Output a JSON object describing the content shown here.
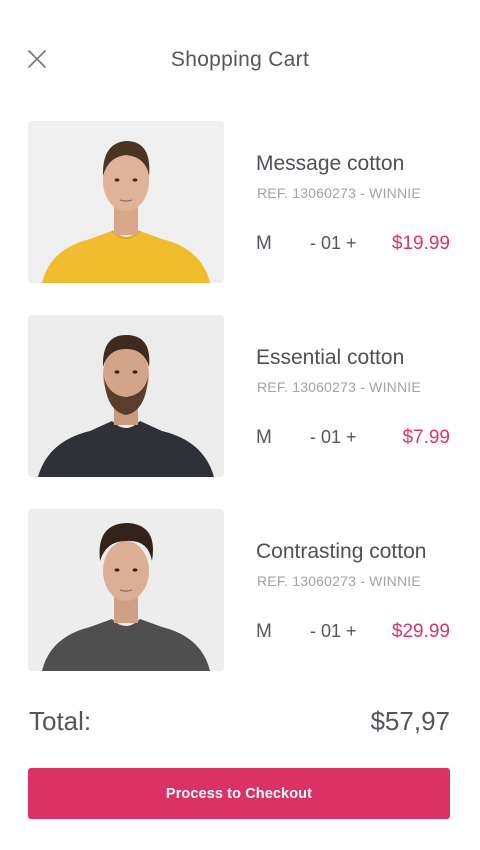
{
  "header": {
    "title": "Shopping Cart",
    "close_icon": "close-icon"
  },
  "cart": {
    "items": [
      {
        "name": "Message cotton",
        "ref": "REF. 13060273 - WINNIE",
        "size": "M",
        "qty_minus": "-",
        "quantity": "01",
        "qty_plus": "+",
        "price": "$19.99",
        "shirt_color": "#f0bb2c"
      },
      {
        "name": "Essential cotton",
        "ref": "REF. 13060273 - WINNIE",
        "size": "M",
        "qty_minus": "-",
        "quantity": "01",
        "qty_plus": "+",
        "price": "$7.99",
        "shirt_color": "#2e3138"
      },
      {
        "name": "Contrasting cotton",
        "ref": "REF. 13060273 - WINNIE",
        "size": "M",
        "qty_minus": "-",
        "quantity": "01",
        "qty_plus": "+",
        "price": "$29.99",
        "shirt_color": "#4f4f50"
      }
    ]
  },
  "summary": {
    "total_label": "Total:",
    "total_value": "$57,97"
  },
  "checkout": {
    "label": "Process to Checkout"
  },
  "colors": {
    "accent": "#dc3165",
    "price": "#d9346a"
  }
}
